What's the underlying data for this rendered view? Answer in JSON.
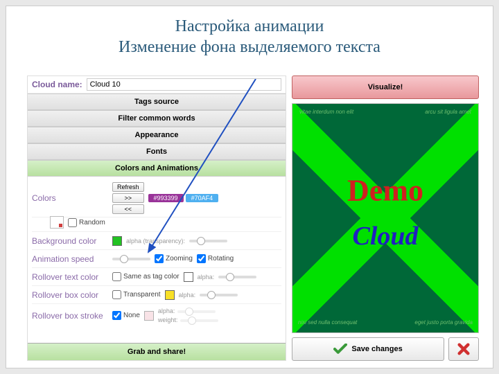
{
  "slide": {
    "title_line1": "Настройка анимации",
    "title_line2": "Изменение фона выделяемого текста"
  },
  "cloud_name": {
    "label": "Cloud name:",
    "value": "Cloud 10"
  },
  "accordions": {
    "tags_source": "Tags source",
    "filter": "Filter common words",
    "appearance": "Appearance",
    "fonts": "Fonts",
    "colors_anim": "Colors and Animations",
    "grab": "Grab and share!"
  },
  "colors_panel": {
    "colors_label": "Colors",
    "refresh": "Refresh",
    "next": ">>",
    "prev": "<<",
    "random": "Random",
    "chip1": {
      "hex": "#993399",
      "label": "#993399"
    },
    "chip2": {
      "hex": "#70AF4",
      "bg": "#4fb0f0"
    },
    "bg_label": "Background color",
    "bg_swatch": "#22c222",
    "alpha_trans": "alpha (transparency):",
    "anim_label": "Animation speed",
    "zooming": "Zooming",
    "rotating": "Rotating",
    "rtc_label": "Rollover text color",
    "same_tag": "Same as tag color",
    "rbc_label": "Rollover box color",
    "transparent": "Transparent",
    "rbs_label": "Rollover box stroke",
    "none": "None",
    "alpha": "alpha:",
    "weight": "weight:",
    "yellow": "#f8e028",
    "pink": "#f4c8d0"
  },
  "right": {
    "visualize": "Visualize!",
    "demo": "Demo",
    "cloud": "Cloud",
    "save": "Save changes"
  }
}
